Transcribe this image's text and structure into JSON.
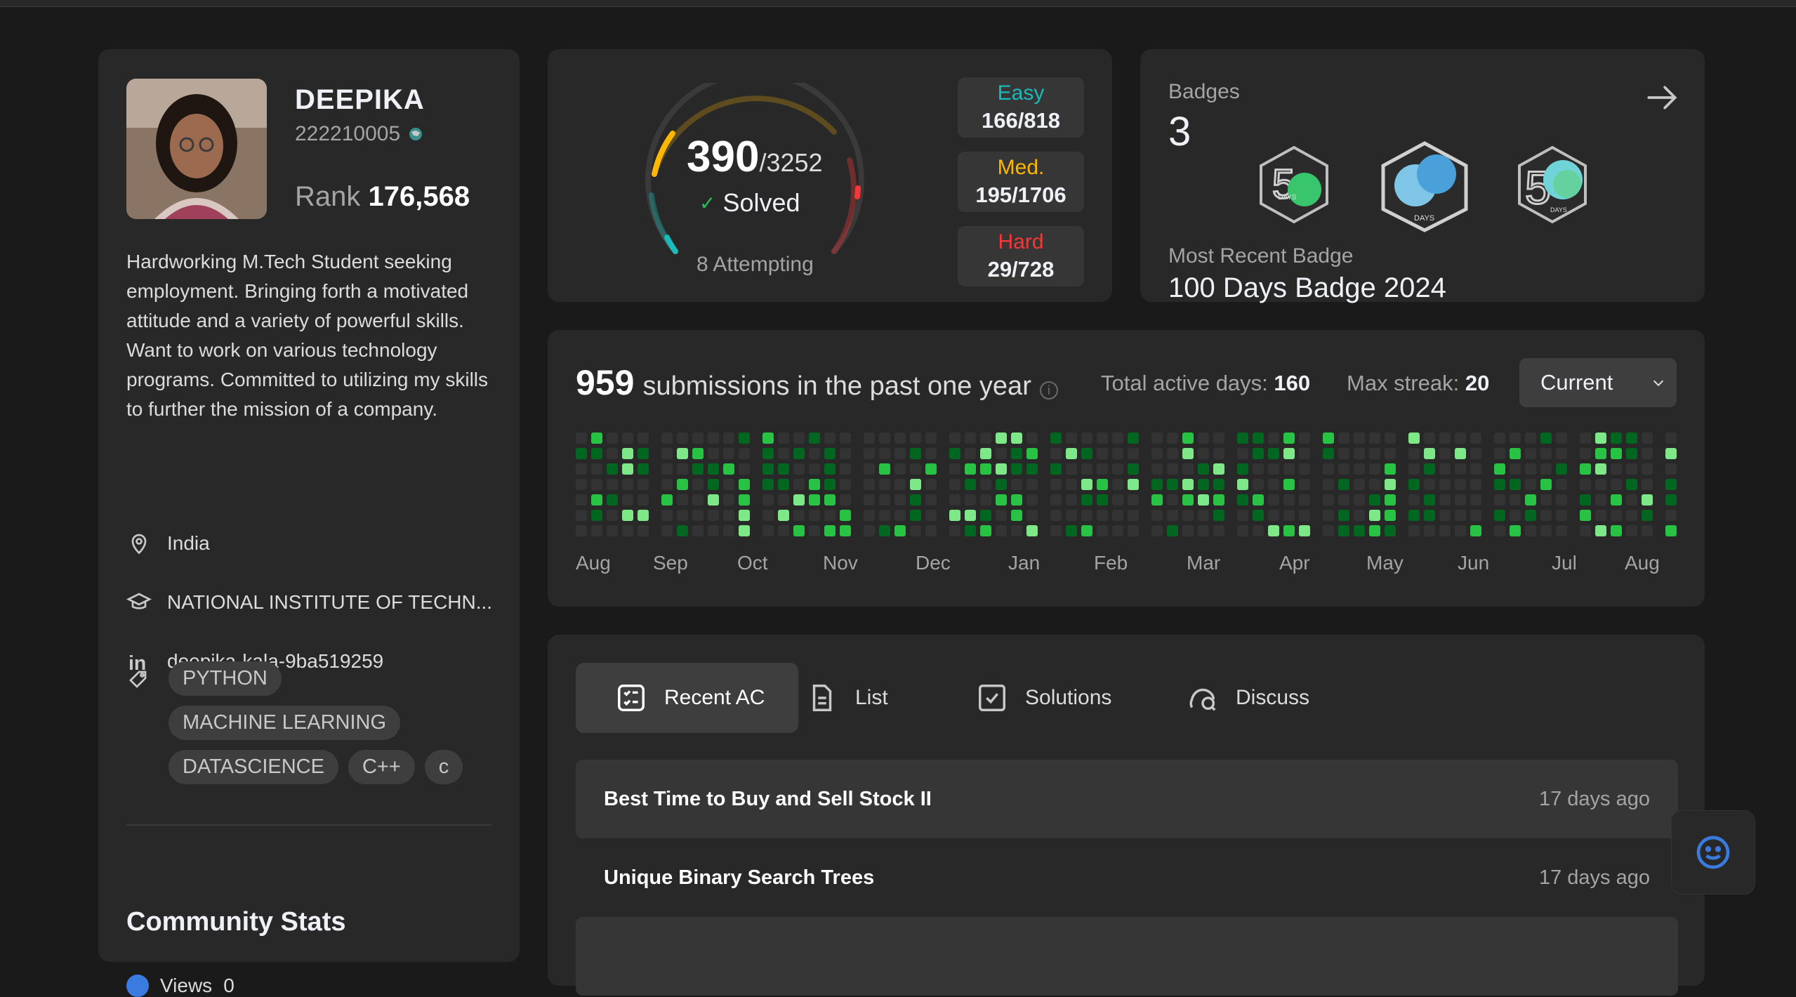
{
  "profile": {
    "name": "DEEPIKA",
    "id": "222210005",
    "rank_label": "Rank",
    "rank_value": "176,568",
    "bio": "Hardworking M.Tech Student seeking employment. Bringing forth a motivated attitude and a variety of powerful skills. Want to work on various technology programs. Committed to utilizing my skills to further the mission of a company.",
    "location": "India",
    "school": "NATIONAL INSTITUTE OF TECHN...",
    "linkedin": "deepika-kala-9ba519259",
    "tags": [
      "PYTHON",
      "MACHINE LEARNING",
      "DATASCIENCE",
      "C++",
      "c"
    ],
    "community_title": "Community Stats",
    "views_label": "Views",
    "views_value": "0"
  },
  "solved": {
    "count": "390",
    "total": "/3252",
    "label": "Solved",
    "attempting": "8 Attempting",
    "easy_label": "Easy",
    "easy_value": "166/818",
    "med_label": "Med.",
    "med_value": "195/1706",
    "hard_label": "Hard",
    "hard_value": "29/728",
    "colors": {
      "easy": "#1cbaba",
      "medium": "#ffb700",
      "hard": "#f63737"
    }
  },
  "badges": {
    "label": "Badges",
    "count": "3",
    "recent_label": "Most Recent Badge",
    "recent_name": "100 Days Badge 2024",
    "icons": [
      "50-days-badge-icon",
      "100-days-badge-icon",
      "50-days-badge-icon"
    ]
  },
  "heatmap": {
    "submissions": "959",
    "submissions_label": "submissions in the past one year",
    "active_label": "Total active days:",
    "active_value": "160",
    "streak_label": "Max streak:",
    "streak_value": "20",
    "select_value": "Current",
    "months": [
      "Aug",
      "Sep",
      "Oct",
      "Nov",
      "Dec",
      "Jan",
      "Feb",
      "Mar",
      "Apr",
      "May",
      "Jun",
      "Jul",
      "Aug"
    ]
  },
  "tabs": {
    "items": [
      {
        "label": "Recent AC"
      },
      {
        "label": "List"
      },
      {
        "label": "Solutions"
      },
      {
        "label": "Discuss"
      }
    ]
  },
  "recent": [
    {
      "title": "Best Time to Buy and Sell Stock II",
      "time": "17 days ago"
    },
    {
      "title": "Unique Binary Search Trees",
      "time": "17 days ago"
    }
  ]
}
